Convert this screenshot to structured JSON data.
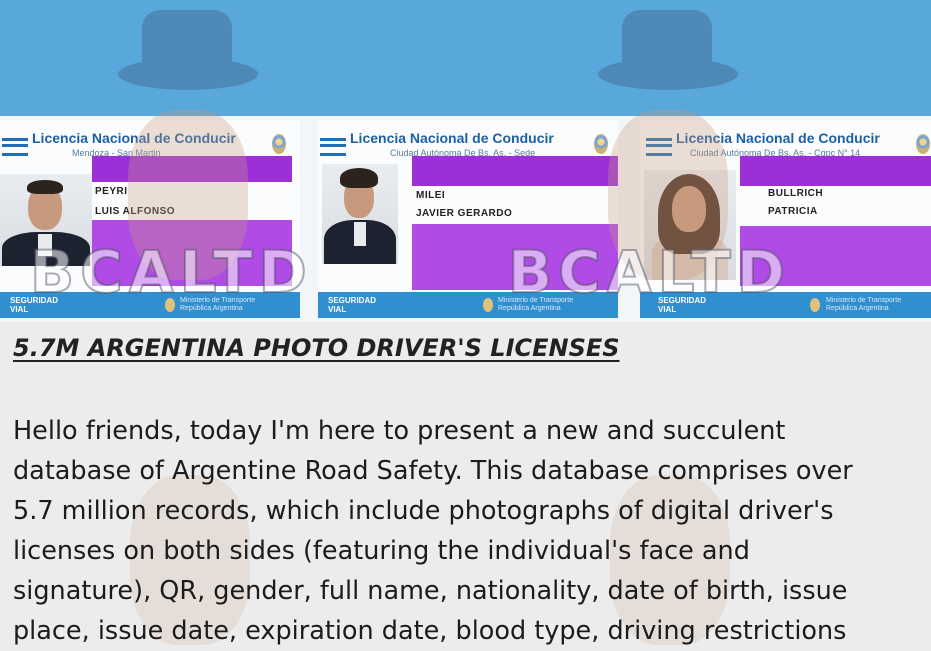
{
  "cards": [
    {
      "title": "Licencia Nacional de Conducir",
      "subtitle": "Mendoza - San Martin",
      "surname": "PEYRI",
      "given_names": "LUIS ALFONSO",
      "footer_left": "SEGURIDAD VIAL",
      "footer_right": "Ministerio de Transporte República Argentina"
    },
    {
      "title": "Licencia Nacional de Conducir",
      "subtitle": "Ciudad Autónoma De Bs. As. - Sede",
      "surname": "MILEI",
      "given_names": "JAVIER GERARDO",
      "footer_left": "SEGURIDAD VIAL",
      "footer_right": "Ministerio de Transporte República Argentina"
    },
    {
      "title": "Licencia Nacional de Conducir",
      "subtitle": "Ciudad Autónoma De Bs. As. - Cgpc N° 14",
      "surname": "BULLRICH",
      "given_names": "PATRICIA",
      "footer_left": "SEGURIDAD VIAL",
      "footer_right": "Ministerio de Transporte República Argentina"
    }
  ],
  "watermark": "BCALTD",
  "post": {
    "heading": "5.7M ARGENTINA PHOTO DRIVER'S LICENSES",
    "lines": [
      "Hello friends, today I'm here to present a new and succulent",
      "database of Argentine Road Safety. This database comprises over",
      "5.7 million records, which include photographs of digital driver's",
      "licenses on both sides (featuring the individual's face and",
      "signature), QR, gender, full name, nationality, date of birth, issue",
      "place, issue date, expiration date, blood type, driving restrictions"
    ]
  },
  "colors": {
    "top_band": "#58a8dc",
    "redaction": "#9d2fd9",
    "license_blue": "#1f5fa8"
  }
}
